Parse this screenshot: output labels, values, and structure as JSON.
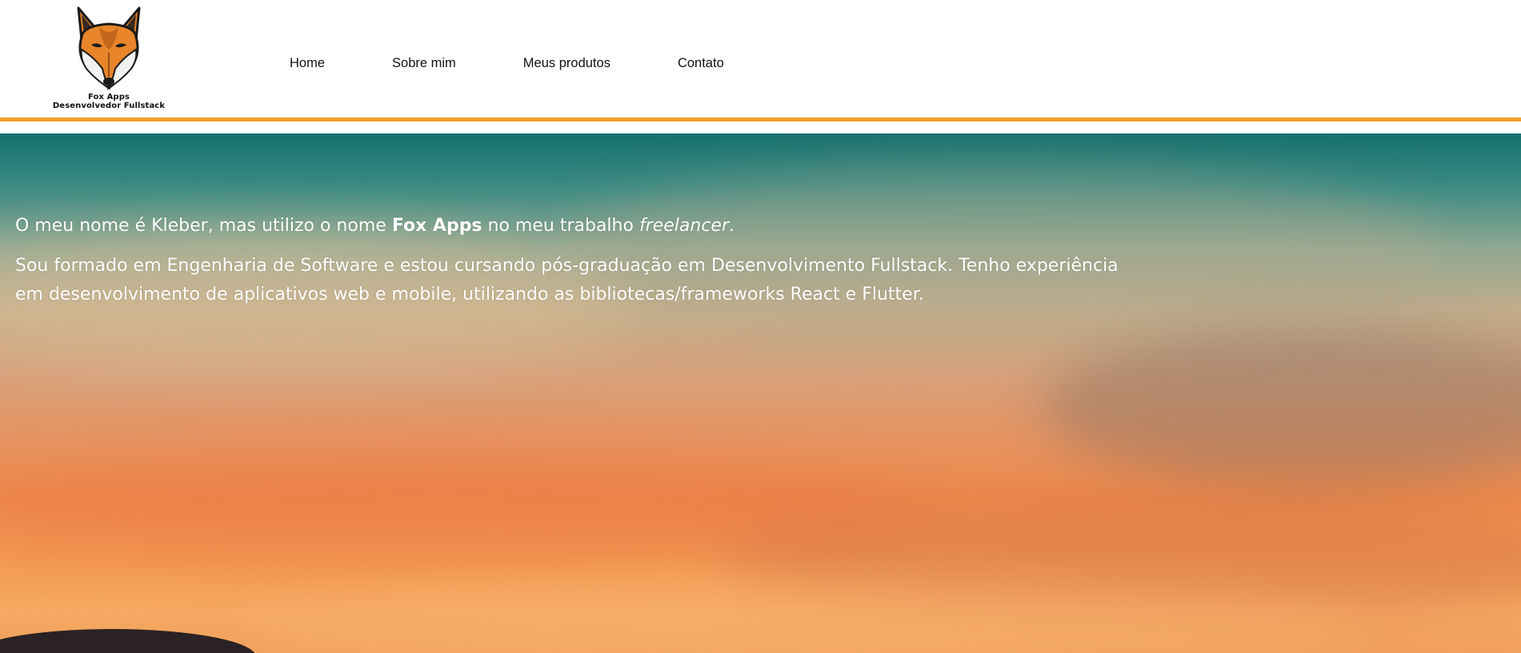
{
  "colors": {
    "accent_line": "#f0a030",
    "nav_text": "#111111",
    "hero_text": "#ffffff",
    "logo_fox_orange": "#e8852a"
  },
  "logo": {
    "icon": "fox-head-icon",
    "line1": "Fox Apps",
    "line2": "Desenvolvedor Fullstack"
  },
  "nav": {
    "items": [
      {
        "label": "Home"
      },
      {
        "label": "Sobre mim"
      },
      {
        "label": "Meus produtos"
      },
      {
        "label": "Contato"
      }
    ]
  },
  "hero": {
    "background": "sunset-sky-image",
    "intro": {
      "before": "O meu nome é Kleber, mas utilizo o nome ",
      "bold": "Fox Apps",
      "middle": " no meu trabalho ",
      "italic": "freelancer",
      "after": "."
    },
    "paragraph": "Sou formado em Engenharia de Software e estou cursando pós-graduação em Desenvolvimento Fullstack. Tenho experiência em desenvolvimento de aplicativos web e mobile, utilizando as bibliotecas/frameworks React e Flutter."
  }
}
